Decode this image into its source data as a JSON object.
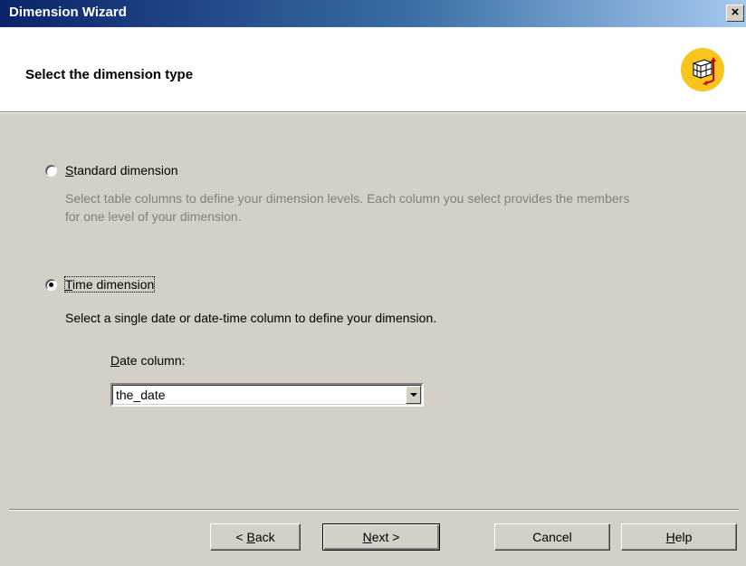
{
  "window": {
    "title": "Dimension Wizard",
    "close_label": "×"
  },
  "header": {
    "heading": "Select the dimension type",
    "logo_icon": "dimension-cube-icon",
    "logo_color": "#f7c51b"
  },
  "options": {
    "standard": {
      "label_mnemonic": "S",
      "label_rest": "tandard dimension",
      "selected": false,
      "description_line1": "Select table columns to define your dimension levels. Each column you select provides the members",
      "description_line2": "for one level of your dimension."
    },
    "time": {
      "label_mnemonic": "T",
      "label_rest": "ime dimension",
      "selected": true,
      "description": "Select a single date or date-time column to define your dimension.",
      "date_column_label_mnemonic": "D",
      "date_column_label_rest": "ate column:",
      "date_column_value": "the_date"
    }
  },
  "buttons": {
    "back": {
      "prefix": "< ",
      "mnemonic": "B",
      "rest": "ack"
    },
    "next": {
      "mnemonic": "N",
      "rest": "ext >"
    },
    "cancel": {
      "label": "Cancel"
    },
    "help": {
      "mnemonic": "H",
      "rest": "elp"
    }
  },
  "colors": {
    "title_gradient_start": "#0a246a",
    "title_gradient_end": "#a6caf0",
    "dialog_bg": "#d4d0c8"
  }
}
